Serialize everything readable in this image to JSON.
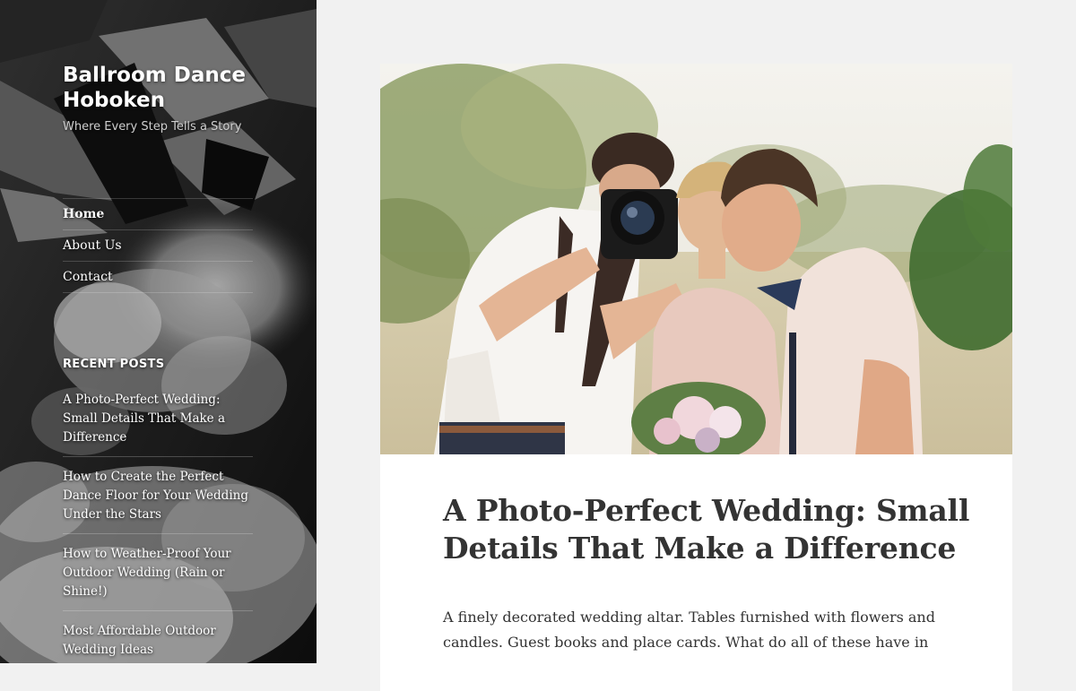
{
  "site": {
    "title": "Ballroom Dance Hoboken",
    "tagline": "Where Every Step Tells a Story"
  },
  "nav": {
    "items": [
      {
        "label": "Home",
        "current": true
      },
      {
        "label": "About Us",
        "current": false
      },
      {
        "label": "Contact",
        "current": false
      }
    ]
  },
  "recent_posts": {
    "heading": "RECENT POSTS",
    "items": [
      {
        "label": "A Photo-Perfect Wedding: Small Details That Make a Difference"
      },
      {
        "label": "How to Create the Perfect Dance Floor for Your Wedding Under the Stars"
      },
      {
        "label": "How to Weather-Proof Your Outdoor Wedding (Rain or Shine!)"
      },
      {
        "label": "Most Affordable Outdoor Wedding Ideas"
      }
    ]
  },
  "post": {
    "title": "A Photo-Perfect Wedding: Small Details That Make a Difference",
    "excerpt": "A finely decorated wedding altar. Tables furnished with flowers and candles. Guest books and place cards. What do all of these have in"
  },
  "colors": {
    "page_bg": "#f1f1f1",
    "sidebar_bg": "#1a1a1a",
    "card_bg": "#ffffff",
    "title_text": "#333333"
  }
}
